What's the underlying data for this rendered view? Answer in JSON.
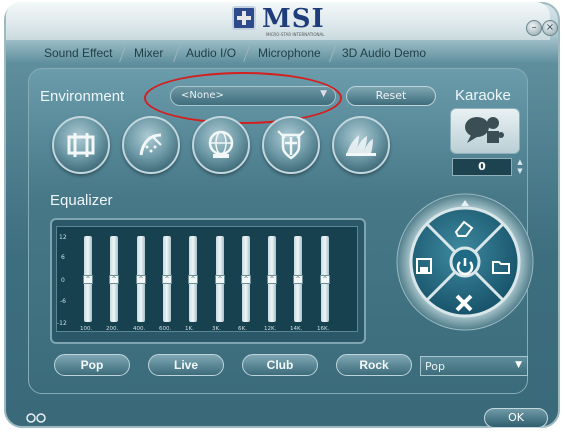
{
  "app": {
    "brand": "MSI",
    "tagline": "MICRO-STAR INTERNATIONAL"
  },
  "window_controls": {
    "minimize": "–",
    "close": "×"
  },
  "tabs": [
    {
      "label": "Sound Effect"
    },
    {
      "label": "Mixer"
    },
    {
      "label": "Audio I/O"
    },
    {
      "label": "Microphone"
    },
    {
      "label": "3D Audio Demo"
    }
  ],
  "environment": {
    "label": "Environment",
    "selected": "<None>",
    "reset_label": "Reset",
    "icons": [
      "bathroom-icon",
      "shower-icon",
      "globe-icon",
      "knight-icon",
      "opera-house-icon"
    ]
  },
  "karaoke": {
    "label": "Karaoke",
    "value": "0"
  },
  "equalizer": {
    "label": "Equalizer",
    "scale": [
      "12",
      "6",
      "0",
      "-6",
      "-12"
    ],
    "bands": [
      "100.",
      "200.",
      "400.",
      "600.",
      "1K.",
      "3K.",
      "6K.",
      "12K.",
      "14K.",
      "16K."
    ],
    "levels_db": [
      0,
      0,
      0,
      0,
      0,
      0,
      0,
      0,
      0,
      0
    ],
    "presets": [
      "Pop",
      "Live",
      "Club",
      "Rock"
    ],
    "preset_selected": "Pop"
  },
  "ok_label": "OK",
  "colors": {
    "highlight": "#d51e1e",
    "accent": "#3d6e7e"
  }
}
